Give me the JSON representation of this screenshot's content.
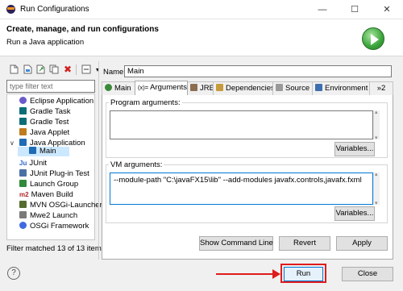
{
  "window": {
    "title": "Run Configurations",
    "minimize": "—",
    "maximize": "☐",
    "close": "✕"
  },
  "header": {
    "title": "Create, manage, and run configurations",
    "subtitle": "Run a Java application"
  },
  "sidebar": {
    "filter_placeholder": "type filter text",
    "items": [
      {
        "label": "Eclipse Application",
        "color": "#6a5acd"
      },
      {
        "label": "Gradle Task",
        "color": "#0a6d78"
      },
      {
        "label": "Gradle Test",
        "color": "#0a6d78"
      },
      {
        "label": "Java Applet",
        "color": "#c07a1e"
      },
      {
        "label": "Java Application",
        "color": "#1f6bb5"
      },
      {
        "label": "Main",
        "color": "#1f6bb5"
      },
      {
        "label": "JUnit",
        "prefix": "Ju",
        "color": "#2b63c9"
      },
      {
        "label": "JUnit Plug-in Test",
        "color": "#4a6fa5"
      },
      {
        "label": "Launch Group",
        "color": "#2f8a3b"
      },
      {
        "label": "Maven Build",
        "prefix": "m2",
        "color": "#b1252b"
      },
      {
        "label": "MVN OSGi-Launcher",
        "color": "#556b2f"
      },
      {
        "label": "Mwe2 Launch",
        "color": "#7a7a7a"
      },
      {
        "label": "OSGi Framework",
        "color": "#4169e1"
      }
    ],
    "filter_status": "Filter matched 13 of 13 item"
  },
  "config": {
    "name_label": "Name:",
    "name_value": "Main",
    "tabs": [
      {
        "label": "Main"
      },
      {
        "label": "Arguments",
        "prefix": "(x)="
      },
      {
        "label": "JRE"
      },
      {
        "label": "Dependencies"
      },
      {
        "label": "Source"
      },
      {
        "label": "Environment"
      },
      {
        "label": "»2"
      }
    ],
    "program_arguments_label": "Program arguments:",
    "program_arguments_value": "",
    "vm_arguments_label": "VM arguments:",
    "vm_arguments_value": "--module-path \"C:\\javaFX15\\lib\" --add-modules javafx.controls,javafx.fxml",
    "variables_button_1": "Variables...",
    "variables_button_2": "Variables...",
    "show_command_line_button": "Show Command Line",
    "revert_button": "Revert",
    "apply_button": "Apply"
  },
  "footer": {
    "help": "?",
    "run_button": "Run",
    "close_button": "Close"
  },
  "colors": {
    "highlight_red": "#e01b1b",
    "selection": "#cce8ff",
    "focus_blue": "#0078d7"
  }
}
